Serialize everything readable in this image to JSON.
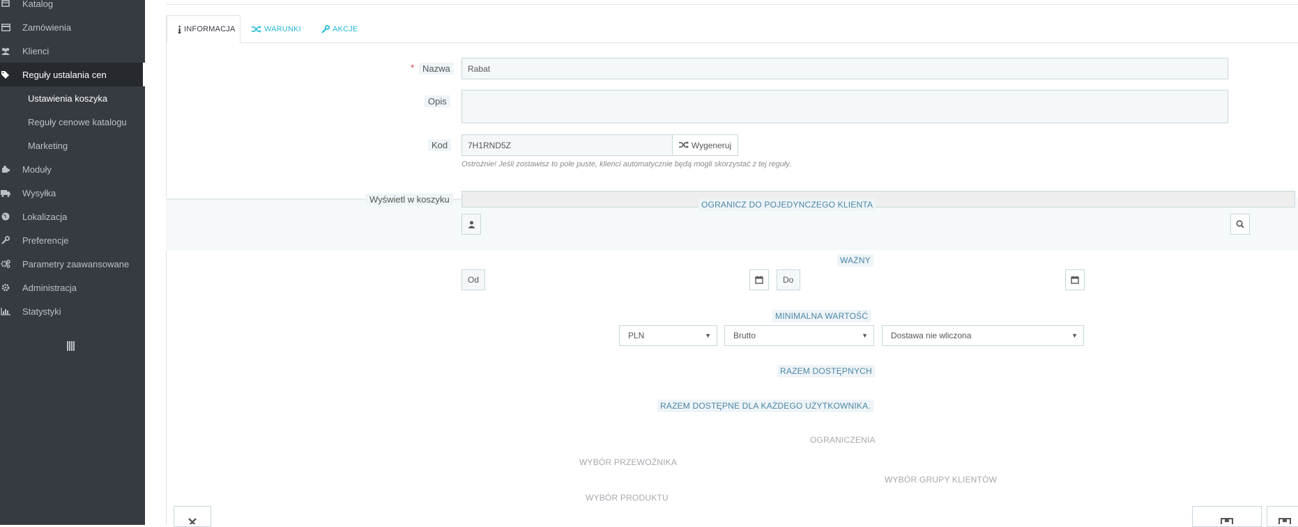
{
  "sidebar": {
    "items": [
      {
        "label": "Katalog",
        "icon": "catalog-icon"
      },
      {
        "label": "Zamówienia",
        "icon": "credit-card-icon"
      },
      {
        "label": "Klienci",
        "icon": "users-icon"
      },
      {
        "label": "Reguły ustalania cen",
        "icon": "tags-icon"
      },
      {
        "label": "Moduły",
        "icon": "puzzle-icon"
      },
      {
        "label": "Wysyłka",
        "icon": "truck-icon"
      },
      {
        "label": "Lokalizacja",
        "icon": "globe-icon"
      },
      {
        "label": "Preferencje",
        "icon": "wrench-icon"
      },
      {
        "label": "Parametry zaawansowane",
        "icon": "cogs-icon"
      },
      {
        "label": "Administracja",
        "icon": "gear-icon"
      },
      {
        "label": "Statystyki",
        "icon": "bar-chart-icon"
      }
    ],
    "subitems": [
      {
        "label": "Ustawienia koszyka"
      },
      {
        "label": "Reguły cenowe katalogu"
      },
      {
        "label": "Marketing"
      }
    ]
  },
  "tabs": [
    {
      "label": "INFORMACJA"
    },
    {
      "label": "WARUNKI"
    },
    {
      "label": "AKCJE"
    }
  ],
  "form": {
    "name_label": "Nazwa",
    "name_required": "*",
    "name_value": "Rabat",
    "description_label": "Opis",
    "description_value": "",
    "code_label": "Kod",
    "code_value": "7H1RND5Z",
    "generate_label": "Wygeneruj",
    "code_help": "Ostrożnie! Jeśli zostawisz to pole puste, klienci automatycznie będą mogli skorzystać z tej reguły.",
    "show_in_cart_label": "Wyświetl w koszyku"
  },
  "conditions": {
    "limit_single_customer": "OGRANICZ DO POJEDYNCZEGO KLIENTA",
    "valid": "WAŻNY",
    "from_placeholder": "Od",
    "to_placeholder": "Do",
    "min_value": "MINIMALNA WARTOŚĆ",
    "currency": "PLN",
    "tax": "Brutto",
    "shipping": "Dostawa nie wliczona",
    "total_available": "RAZEM DOSTĘPNYCH",
    "total_per_user": "RAZEM DOSTĘPNE DLA KAŻDEGO UŻYTKOWNIKA.",
    "restrictions": "OGRANICZENIA",
    "carrier_selection": "WYBÓR PRZEWOŹNIKA",
    "customer_group_selection": "WYBÓR GRUPY KLIENTÓW",
    "product_selection": "WYBÓR PRODUKTU"
  },
  "colors": {
    "sidebar_bg": "#363a41",
    "accent": "#25b9d7",
    "required": "#e84e6a"
  }
}
